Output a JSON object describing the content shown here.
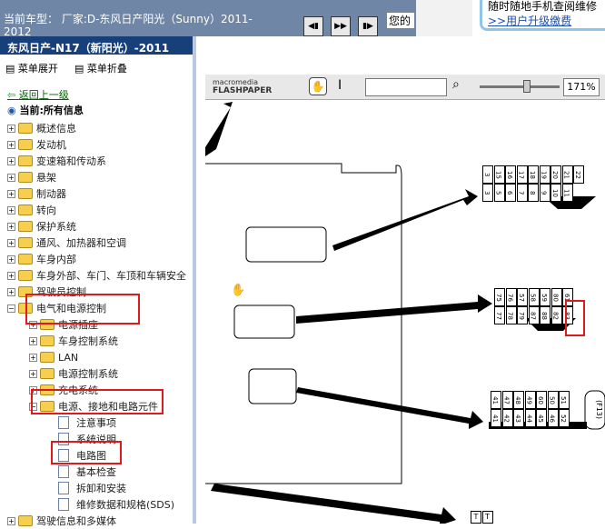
{
  "top": {
    "vehicle": "当前车型： 厂家:D-东风日产阳光（Sunny）2011-2012",
    "notice": "您的",
    "promo": {
      "line1": "随时随地手机查阅维修",
      "line2": ">>用户升级缴费"
    }
  },
  "sidebar": {
    "title": "东风日产-N17（新阳光）-2011",
    "expand": "菜单展开",
    "collapse": "菜单折叠",
    "back": "返回上一级",
    "current": "当前:所有信息",
    "items": [
      "概述信息",
      "发动机",
      "变速箱和传动系",
      "悬架",
      "制动器",
      "转向",
      "保护系统",
      "通风、加热器和空调",
      "车身内部",
      "车身外部、车门、车顶和车辆安全",
      "驾驶员控制",
      "电气和电源控制",
      "电源插座",
      "车身控制系统",
      "LAN",
      "电源控制系统",
      "充电系统",
      "电源、接地和电路元件",
      "注意事项",
      "系统说明",
      "电路图",
      "基本检查",
      "拆卸和安装",
      "维修数据和规格(SDS)",
      "驾驶信息和多媒体"
    ]
  },
  "viewer": {
    "logo_top": "macromedia",
    "logo_bottom": "FLASHPAPER",
    "zoom": "171%",
    "search_value": ""
  },
  "diagram": {
    "row1_top": [
      "3",
      "15",
      "16",
      "17",
      "18",
      "19",
      "20",
      "21",
      "22"
    ],
    "row1_bot": [
      "3",
      "5",
      "6",
      "7",
      "8",
      "9",
      "10",
      "11"
    ],
    "row2_top": [
      "75",
      "76",
      "57",
      "58",
      "59",
      "80",
      "61"
    ],
    "row2_bot": [
      "77",
      "78",
      "79",
      "87",
      "88",
      "82",
      "83"
    ],
    "row3_top": [
      "41",
      "47",
      "48",
      "49",
      "60",
      "50",
      "51"
    ],
    "row3_bot": [
      "41",
      "42",
      "43",
      "44",
      "45",
      "46",
      "52"
    ],
    "conn_label": "(F13)",
    "bottom_cells": [
      "T",
      "T"
    ]
  }
}
